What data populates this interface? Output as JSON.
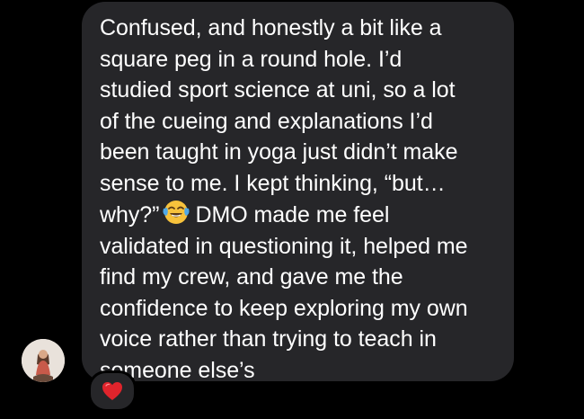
{
  "message": {
    "lines": [
      "Confused, and honestly a bit like a",
      "square peg in a round hole. I’d",
      "studied sport science at uni, so a lot",
      "of the cueing and explanations I’d",
      "been taught in yoga just didn’t make",
      "sense to me. I kept thinking, “but…",
      "why?”",
      "DMO made me feel",
      "validated in questioning it, helped me",
      "find my crew, and gave me the",
      "confidence to keep exploring my own",
      "voice rather than trying to teach in",
      "someone else’s"
    ],
    "emoji": "face-with-tears-of-joy-emoji"
  },
  "reaction": {
    "icon": "red-heart-icon"
  },
  "colors": {
    "background": "#000000",
    "bubble": "#262629",
    "text": "#ffffff",
    "heart": "#e0242c"
  }
}
